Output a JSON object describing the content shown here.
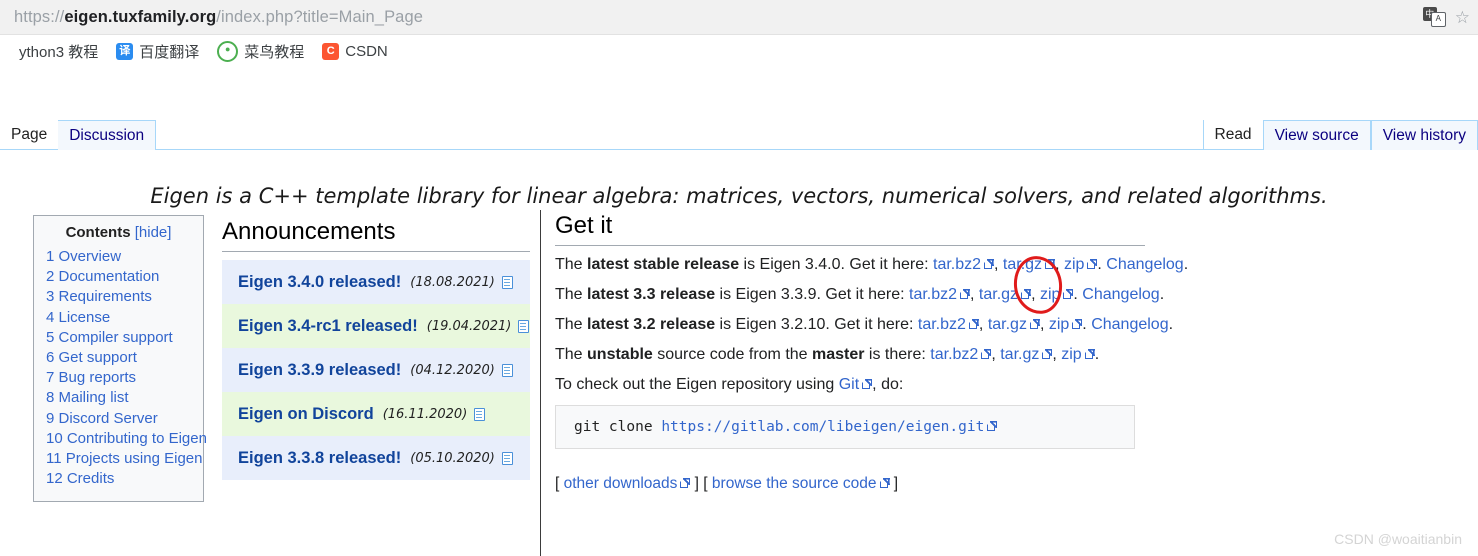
{
  "browser": {
    "url_prefix": "https://",
    "url_host": "eigen.tuxfamily.org",
    "url_path": "/index.php?title=Main_Page",
    "translate_icon": "translate-icon",
    "translate_cn": "中",
    "translate_a": "A",
    "star_icon": "star-icon",
    "bookmarks": [
      {
        "label": "ython3 教程",
        "icon": "none",
        "icon_text": ""
      },
      {
        "label": "百度翻译",
        "icon": "baidu-translate-icon",
        "icon_text": "译"
      },
      {
        "label": "菜鸟教程",
        "icon": "runoob-icon",
        "icon_text": "●"
      },
      {
        "label": "CSDN",
        "icon": "csdn-icon",
        "icon_text": "C"
      }
    ]
  },
  "tabs": {
    "left": [
      {
        "label": "Page",
        "state": "active"
      },
      {
        "label": "Discussion",
        "state": "inactive"
      }
    ],
    "right": [
      {
        "label": "Read",
        "state": "active"
      },
      {
        "label": "View source",
        "state": "inactive"
      },
      {
        "label": "View history",
        "state": "inactive"
      }
    ]
  },
  "tagline": "Eigen is a C++ template library for linear algebra: matrices, vectors, numerical solvers, and related algorithms.",
  "toc": {
    "title": "Contents",
    "hide_label": "[hide]",
    "items": [
      "1 Overview",
      "2 Documentation",
      "3 Requirements",
      "4 License",
      "5 Compiler support",
      "6 Get support",
      "7 Bug reports",
      "8 Mailing list",
      "9 Discord Server",
      "10 Contributing to Eigen",
      "11 Projects using Eigen",
      "12 Credits"
    ]
  },
  "announcements": {
    "heading": "Announcements",
    "rows": [
      {
        "title": "Eigen 3.4.0 released!",
        "date": "(18.08.2021)",
        "shade": "blue"
      },
      {
        "title": "Eigen 3.4-rc1 released!",
        "date": "(19.04.2021)",
        "shade": "green"
      },
      {
        "title": "Eigen 3.3.9 released!",
        "date": "(04.12.2020)",
        "shade": "blue"
      },
      {
        "title": "Eigen on Discord",
        "date": "(16.11.2020)",
        "shade": "green"
      },
      {
        "title": "Eigen 3.3.8 released!",
        "date": "(05.10.2020)",
        "shade": "blue"
      }
    ]
  },
  "getit": {
    "heading": "Get it",
    "lines": [
      {
        "pre": "The ",
        "bold": "latest stable release",
        "mid": " is Eigen 3.4.0. Get it here: ",
        "links": [
          "tar.bz2",
          "tar.gz",
          "zip"
        ],
        "post": ". ",
        "trailing_link": "Changelog",
        "end": "."
      },
      {
        "pre": "The ",
        "bold": "latest 3.3 release",
        "mid": " is Eigen 3.3.9. Get it here: ",
        "links": [
          "tar.bz2",
          "tar.gz",
          "zip"
        ],
        "post": ". ",
        "trailing_link": "Changelog",
        "end": "."
      },
      {
        "pre": "The ",
        "bold": "latest 3.2 release",
        "mid": " is Eigen 3.2.10. Get it here: ",
        "links": [
          "tar.bz2",
          "tar.gz",
          "zip"
        ],
        "post": ". ",
        "trailing_link": "Changelog",
        "end": "."
      },
      {
        "pre": "The ",
        "bold": "unstable",
        "mid": " source code from the ",
        "bold2": "master",
        "mid2": " is there: ",
        "links": [
          "tar.bz2",
          "tar.gz",
          "zip"
        ],
        "post": ".",
        "trailing_link": "",
        "end": ""
      }
    ],
    "git_line_pre": "To check out the Eigen repository using ",
    "git_link": "Git",
    "git_line_post": ", do:",
    "code_cmd": "git clone ",
    "code_url": "https://gitlab.com/libeigen/eigen.git",
    "footer_open": "[ ",
    "footer_link1": "other downloads",
    "footer_mid": " ] [ ",
    "footer_link2": "browse the source code",
    "footer_close": " ]"
  },
  "annotation": {
    "name": "red-circle-highlight",
    "color": "#e01b1b"
  },
  "watermark": "CSDN @woaitianbin"
}
